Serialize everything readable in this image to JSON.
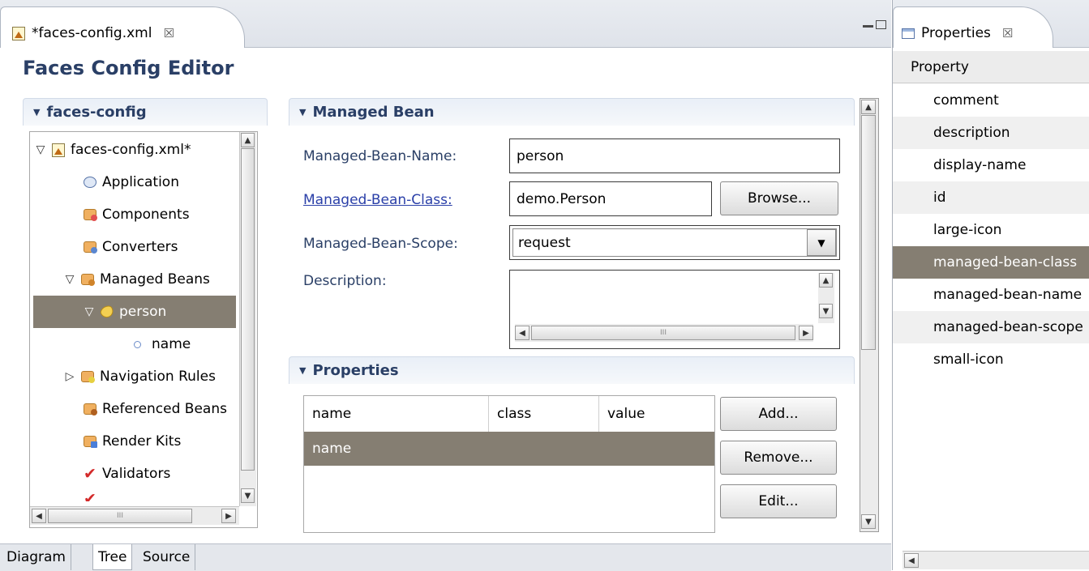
{
  "editor": {
    "tab_label": "*faces-config.xml",
    "tab_close_glyph": "☒",
    "title": "Faces Config Editor",
    "tree_section_title": "faces-config",
    "tree": [
      {
        "label": "faces-config.xml*",
        "icon": "faces-config-file-icon",
        "expanded": true
      },
      {
        "label": "Application",
        "icon": "application-icon"
      },
      {
        "label": "Components",
        "icon": "components-folder-icon"
      },
      {
        "label": "Converters",
        "icon": "converters-folder-icon"
      },
      {
        "label": "Managed Beans",
        "icon": "managed-beans-folder-icon",
        "expanded": true
      },
      {
        "label": "person",
        "icon": "bean-icon",
        "expanded": true,
        "selected": true
      },
      {
        "label": "name",
        "icon": "property-dot-icon"
      },
      {
        "label": "Navigation Rules",
        "icon": "navigation-folder-icon",
        "expanded": false
      },
      {
        "label": "Referenced Beans",
        "icon": "referenced-beans-folder-icon"
      },
      {
        "label": "Render Kits",
        "icon": "render-kits-folder-icon"
      },
      {
        "label": "Validators",
        "icon": "validators-check-icon"
      }
    ],
    "managed_bean": {
      "section_title": "Managed Bean",
      "name_label": "Managed-Bean-Name:",
      "name_value": "person",
      "class_label": "Managed-Bean-Class:",
      "class_value": "demo.Person",
      "browse_label": "Browse...",
      "scope_label": "Managed-Bean-Scope:",
      "scope_value": "request",
      "description_label": "Description:",
      "description_value": ""
    },
    "properties_section": {
      "section_title": "Properties",
      "columns": [
        "name",
        "class",
        "value"
      ],
      "rows": [
        {
          "name": "name",
          "class": "",
          "value": ""
        }
      ],
      "add_label": "Add...",
      "remove_label": "Remove...",
      "edit_label": "Edit..."
    },
    "bottom_tabs": [
      "Diagram",
      "Tree",
      "Source"
    ],
    "active_bottom_tab": "Tree",
    "selection_color": "#857e72",
    "heading_color": "#2a3f66"
  },
  "properties_view": {
    "tab_label": "Properties",
    "tab_close_glyph": "☒",
    "header": "Property",
    "rows": [
      "comment",
      "description",
      "display-name",
      "id",
      "large-icon",
      "managed-bean-class",
      "managed-bean-name",
      "managed-bean-scope",
      "small-icon"
    ],
    "selected_row": "managed-bean-class"
  }
}
